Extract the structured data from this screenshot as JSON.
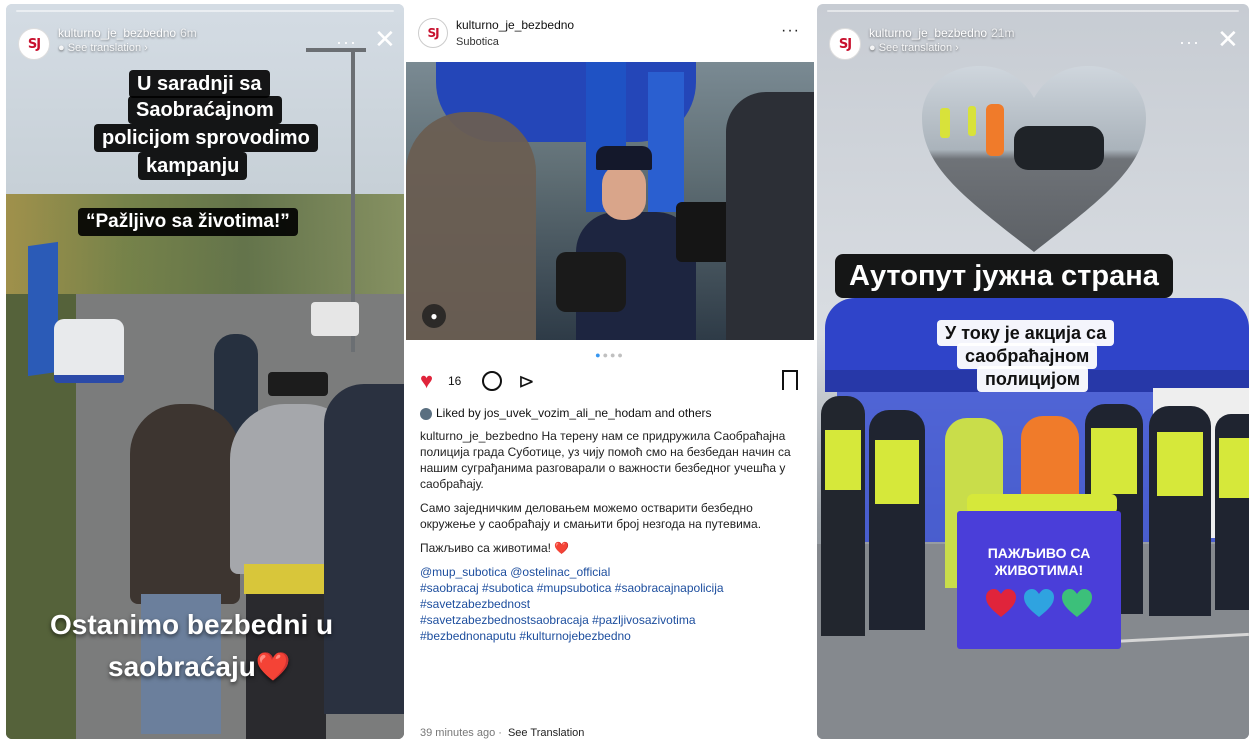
{
  "story1": {
    "username": "kulturno_je_bezbedno",
    "time": "6m",
    "see_translation": "See translation",
    "logo_text": "SЈ",
    "caption_lines": [
      "U saradnji sa",
      "Saobraćajnom",
      "policijom sprovodimo",
      "kampanju"
    ],
    "slogan": "“Pažljivo sa životima!”",
    "bottom_line1": "Ostanimo bezbedni u",
    "bottom_line2": "saobraćaju❤️"
  },
  "post": {
    "username": "kulturno_je_bezbedno",
    "location": "Subotica",
    "logo_text": "SЈ",
    "likes": "16",
    "liked_by": "Liked by jos_uvek_vozim_ali_ne_hodam and others",
    "caption_user": "kulturno_je_bezbedno",
    "caption_text": "На терену нам се придружила Саобраћајна полиција града Суботице, уз чију помоћ смо на безбедан начин са нашим суграђанима разговарали о важности безбедног учешћа у саобраћају.",
    "caption_p2": "Само заједничким деловањем можемо остварити безбедно окружење у саобраћају и смањити број незгода на путевима.",
    "caption_p3": "Пажљиво са животима! ❤️",
    "tags_line1": "@mup_subotica @ostelinac_official",
    "tags_line2": "#saobracaj #subotica #mupsubotica #saobracajnapolicija",
    "tags_line3": "#savetzabezbednost",
    "tags_line4": "#savetzabezbednostsaobracaja #pazljivosazivotima",
    "tags_line5": "#bezbednonaputu #kulturnojebezbedno",
    "time_ago": "39 minutes ago",
    "see_translation": "See Translation"
  },
  "story3": {
    "username": "kulturno_je_bezbedno",
    "time": "21m",
    "see_translation": "See translation",
    "logo_text": "SЈ",
    "headline": "Аутопут јужна страна",
    "sub_lines": [
      "У току је акција са",
      "саобраћајном",
      "полицијом"
    ],
    "table_line1": "ПАЖЉИВО СА",
    "table_line2": "ЖИВОТИМА!"
  },
  "colors": {
    "heart_red": "#e0243b",
    "tent_blue": "#2f44c9",
    "table_purple": "#4a3ed9",
    "vest_yellow": "#d6e83a",
    "tag_blue": "#1d4e9e"
  }
}
